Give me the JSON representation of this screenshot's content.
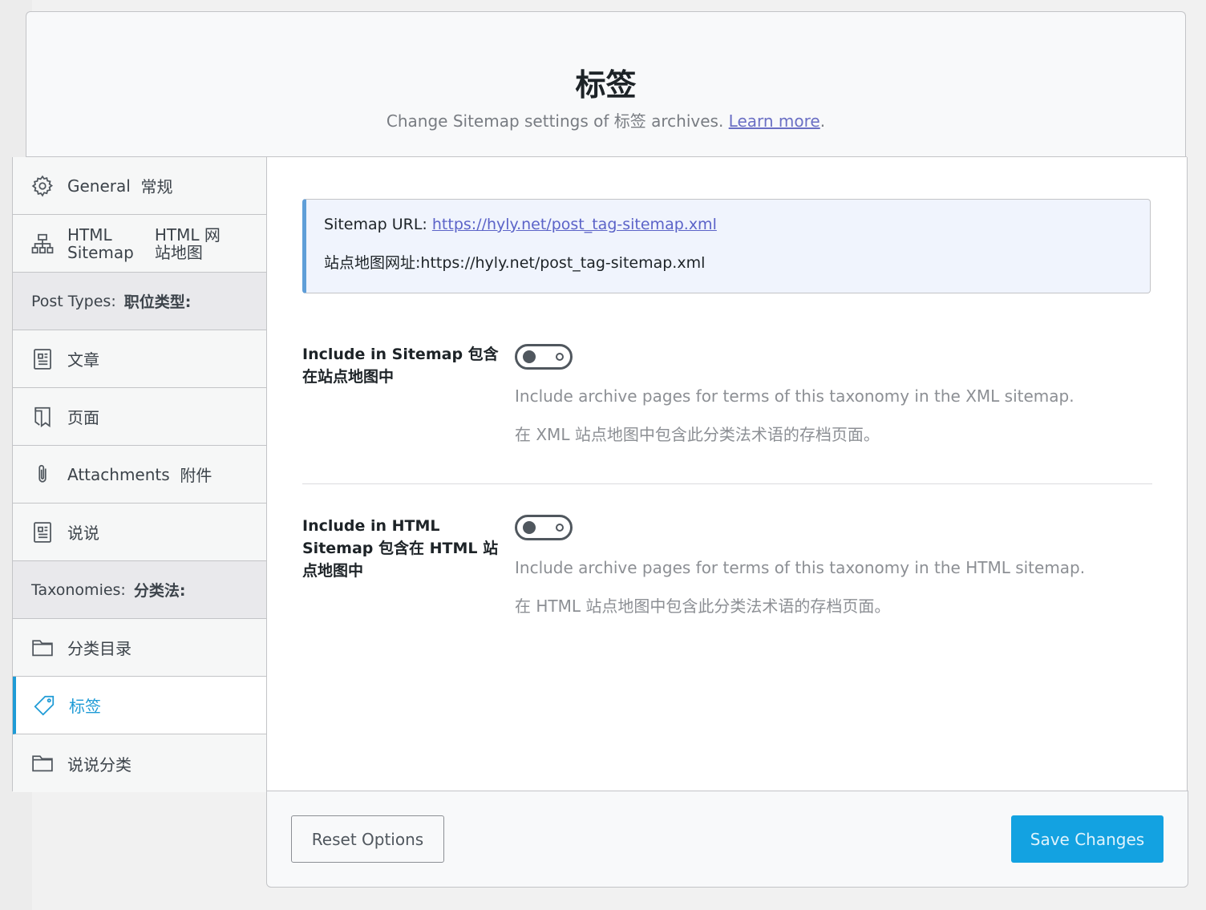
{
  "header": {
    "title": "标签",
    "subtitle": "Change Sitemap settings of 标签 archives.",
    "learn_more": "Learn more",
    "period": "."
  },
  "sidebar": {
    "general": {
      "en": "General",
      "zh": "常规"
    },
    "html_sitemap": {
      "en1": "HTML",
      "en2": "Sitemap",
      "zh1": "HTML 网",
      "zh2": "站地图"
    },
    "post_types": {
      "en": "Post Types:",
      "zh": "职位类型:"
    },
    "articles": "文章",
    "pages": "页面",
    "attachments": {
      "en": "Attachments",
      "zh": "附件"
    },
    "shuoshuo": "说说",
    "taxonomies": {
      "en": "Taxonomies:",
      "zh": "分类法:"
    },
    "categories": "分类目录",
    "tags": "标签",
    "shuoshuo_categories": "说说分类"
  },
  "notice": {
    "url_label": "Sitemap URL:",
    "url": "https://hyly.net/post_tag-sitemap.xml",
    "zh_label": "站点地图网址:",
    "zh_url": "https://hyly.net/post_tag-sitemap.xml"
  },
  "options": {
    "xml": {
      "label": "Include in Sitemap  包含在站点地图中",
      "enabled": false,
      "desc_en": "Include archive pages for terms of this taxonomy in the XML sitemap.",
      "desc_zh": "在 XML 站点地图中包含此分类法术语的存档页面。"
    },
    "html": {
      "label": "Include in HTML Sitemap  包含在 HTML 站点地图中",
      "enabled": false,
      "desc_en": "Include archive pages for terms of this taxonomy in the HTML sitemap.",
      "desc_zh": "在 HTML 站点地图中包含此分类法术语的存档页面。"
    }
  },
  "footer": {
    "reset": "Reset Options",
    "save": "Save Changes"
  },
  "colors": {
    "accent": "#1e9bd6",
    "save_button": "#13a2e1",
    "link": "#5b63c8"
  }
}
